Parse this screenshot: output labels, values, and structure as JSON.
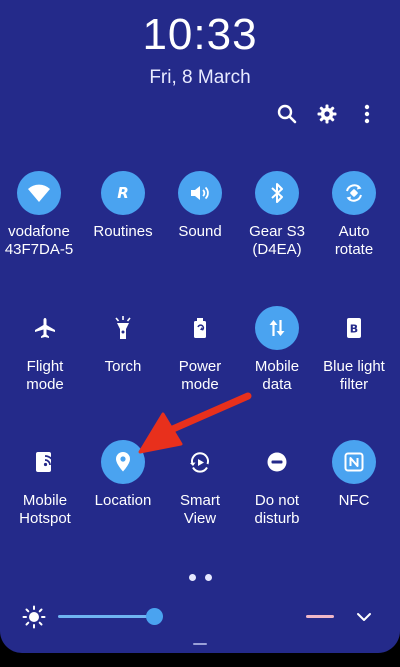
{
  "status": {
    "time": "10:33",
    "date": "Fri, 8 March"
  },
  "top_actions": [
    "search-icon",
    "gear-icon",
    "more-vertical-icon"
  ],
  "tiles": {
    "row1": [
      {
        "label": "vodafone\n43F7DA-5",
        "icon": "wifi-icon",
        "on": true
      },
      {
        "label": "Routines",
        "icon": "routines-icon",
        "on": true
      },
      {
        "label": "Sound",
        "icon": "sound-icon",
        "on": true
      },
      {
        "label": "Gear S3\n(D4EA)",
        "icon": "bluetooth-icon",
        "on": true
      },
      {
        "label": "Auto\nrotate",
        "icon": "auto-rotate-icon",
        "on": true
      }
    ],
    "row2": [
      {
        "label": "Flight\nmode",
        "icon": "airplane-icon",
        "on": false
      },
      {
        "label": "Torch",
        "icon": "torch-icon",
        "on": false
      },
      {
        "label": "Power\nmode",
        "icon": "battery-icon",
        "on": false
      },
      {
        "label": "Mobile\ndata",
        "icon": "mobile-data-icon",
        "on": true
      },
      {
        "label": "Blue light\nfilter",
        "icon": "blue-light-icon",
        "on": false
      }
    ],
    "row3": [
      {
        "label": "Mobile\nHotspot",
        "icon": "hotspot-icon",
        "on": false
      },
      {
        "label": "Location",
        "icon": "location-pin-icon",
        "on": true
      },
      {
        "label": "Smart\nView",
        "icon": "smart-view-icon",
        "on": false
      },
      {
        "label": "Do not\ndisturb",
        "icon": "do-not-disturb-icon",
        "on": false
      },
      {
        "label": "NFC",
        "icon": "nfc-icon",
        "on": true
      }
    ]
  },
  "pager": {
    "pages": 2,
    "current": 1
  },
  "brightness": {
    "level": 0.3
  },
  "colors": {
    "panel": "#242a8a",
    "tile_on": "#4aa3f0",
    "annotation_arrow": "#e8301c"
  }
}
